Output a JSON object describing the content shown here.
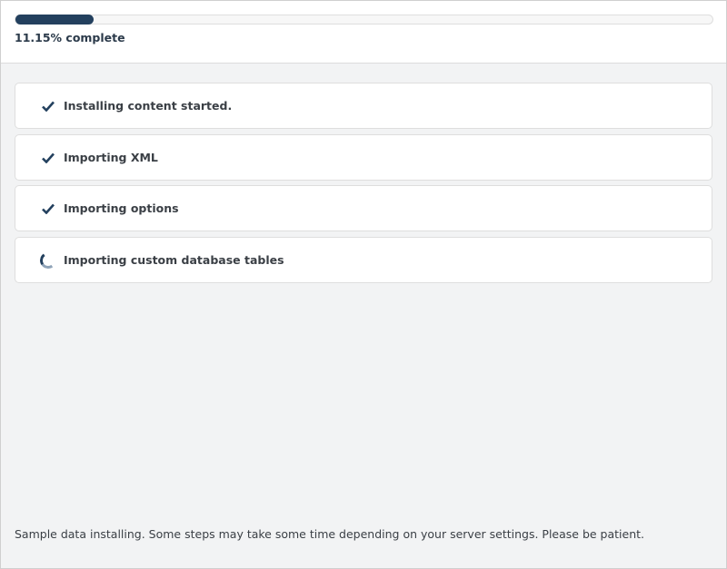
{
  "progress": {
    "percent": 11.15,
    "label": "11.15% complete",
    "color": "#23405e"
  },
  "steps": [
    {
      "label": "Installing content started.",
      "status": "done",
      "icon": "check-icon"
    },
    {
      "label": "Importing XML",
      "status": "done",
      "icon": "check-icon"
    },
    {
      "label": "Importing options",
      "status": "done",
      "icon": "check-icon"
    },
    {
      "label": "Importing custom database tables",
      "status": "in-progress",
      "icon": "spinner-icon"
    }
  ],
  "footer": {
    "text": "Sample data installing. Some steps may take some time depending on your server settings. Please be patient."
  }
}
